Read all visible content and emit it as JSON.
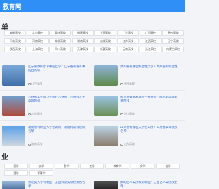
{
  "header": {
    "site_title": "教育网"
  },
  "section1": {
    "title": "单"
  },
  "provinces": [
    "安徽高校",
    "北京高校",
    "重庆高校",
    "福建高校",
    "甘肃高校",
    "广东高校",
    "广西高校",
    "贵州高校",
    "河北高校",
    "河南高校",
    "湖北高校",
    "湖南高校",
    "吉林高校",
    "江苏高校",
    "江西高校",
    "辽宁高校",
    "陕西高校",
    "上海高校",
    "四川高校",
    "天津高校",
    "新疆高校",
    "云南高校",
    "浙江高校",
    "内蒙古高校"
  ],
  "cards": [
    {
      "title": "辽宁省教育厅军事成立学？辽宁省有省军事成立高校",
      "meta": "辽宁高校",
      "img_theme": "blue"
    },
    {
      "title": "贵州省有哪些综合性大学？贵州省有综合性",
      "meta": "贵州高校",
      "img_theme": "green"
    },
    {
      "title": "吉林省工业成立学校在吉林省？吉林有大学高等院校",
      "meta": "吉林高校",
      "img_theme": "red"
    },
    {
      "title": "丽水省数据管理大学有哪些？丽水有高等教育院校",
      "meta": "浙江高校",
      "img_theme": "campus"
    },
    {
      "title": "湖南省有哪些大学在湖南？湖南有高等院校名单",
      "meta": "湖南高校",
      "img_theme": "sky"
    },
    {
      "title": "山东省有哪些大学在山东？山东省高等院校名单",
      "meta": "山东高校",
      "img_theme": "gate"
    }
  ],
  "section2": {
    "title": "业"
  },
  "subjects": [
    "医学",
    "农学",
    "哲学",
    "工学",
    "教育学",
    "文学",
    "法学",
    "理学",
    "军事学"
  ],
  "bottom_cards": [
    {
      "title": "师范类大学有哪些？全国师范类院校排名名单"
    },
    {
      "title": "舞蹈艺术类学校有哪些？全国艺术类院校名单"
    }
  ],
  "colors": {
    "accent": "#2f8ff7",
    "link": "#2f6ad9"
  }
}
